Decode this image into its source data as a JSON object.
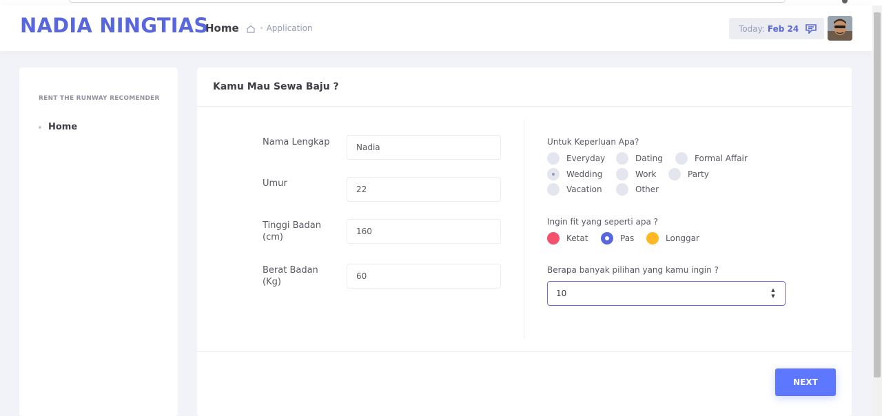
{
  "header": {
    "brand": "NADIA NINGTIAS",
    "breadcrumb": {
      "home": "Home",
      "separator": "•",
      "current": "Application"
    },
    "today_label": "Today:",
    "today_value": "Feb 24",
    "icons": [
      "home-icon",
      "calendar-icon",
      "avatar"
    ]
  },
  "sidebar": {
    "section_title": "RENT THE RUNWAY RECOMENDER",
    "items": [
      {
        "label": "Home"
      }
    ]
  },
  "form": {
    "title": "Kamu Mau Sewa Baju ?",
    "fields": {
      "nama": {
        "label": "Nama Lengkap",
        "value": "Nadia"
      },
      "umur": {
        "label": "Umur",
        "value": "22"
      },
      "tinggi": {
        "label_1": "Tinggi Badan",
        "label_2": "(cm)",
        "value": "160"
      },
      "berat": {
        "label_1": "Berat Badan",
        "label_2": "(Kg)",
        "value": "60"
      }
    },
    "keperluan": {
      "question": "Untuk Keperluan Apa?",
      "options": [
        "Everyday",
        "Dating",
        "Formal Affair",
        "Wedding",
        "Work",
        "Party",
        "Vacation",
        "Other"
      ],
      "selected": "Wedding"
    },
    "fit": {
      "question": "Ingin fit yang seperti apa ?",
      "options": [
        "Ketat",
        "Pas",
        "Longgar"
      ],
      "colors": [
        "#f4516c",
        "#5867dd",
        "#ffb822"
      ],
      "selected": "Pas"
    },
    "jumlah": {
      "question": "Berapa banyak pilihan yang kamu ingin ?",
      "value": "10",
      "spin_up": "▲",
      "spin_down": "▼"
    },
    "next_label": "NEXT"
  }
}
